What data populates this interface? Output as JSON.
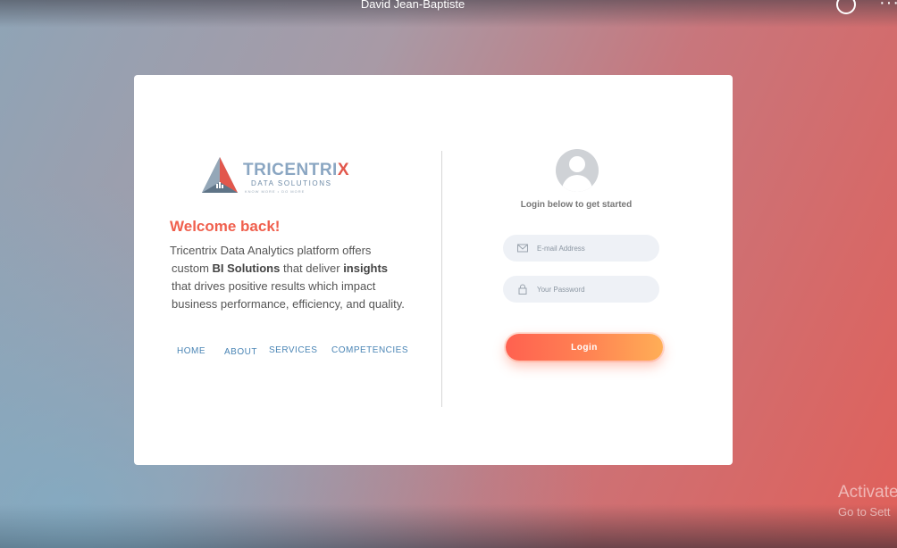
{
  "topbar": {
    "user_name": "David Jean-Baptiste",
    "menu_glyph": "···"
  },
  "logo": {
    "name_main": "TRICENTRI",
    "name_x": "X",
    "subtitle": "DATA SOLUTIONS",
    "tagline": "KNOW MORE • DO MORE"
  },
  "left": {
    "welcome": "Welcome back!",
    "desc_line1": "Tricentrix Data Analytics platform offers",
    "desc_line2_pre": "custom ",
    "desc_line2_bold1": "BI Solutions",
    "desc_line2_mid": " that deliver ",
    "desc_line2_bold2": "insights",
    "desc_line3": "that drives positive results which impact",
    "desc_line4": "business performance, efficiency, and quality.",
    "nav": [
      "HOME",
      "ABOUT",
      "SERVICES",
      "COMPETENCIES"
    ]
  },
  "right": {
    "subtitle": "Login below to get started",
    "email_placeholder": "E-mail Address",
    "password_placeholder": "Your Password",
    "login_label": "Login"
  },
  "watermark": {
    "line1": "Activate",
    "line2": "Go to Sett"
  },
  "colors": {
    "accent": "#f0604e",
    "nav": "#4a85b5",
    "button_start": "#ff6150",
    "button_end": "#ffae56"
  },
  "icons": [
    "user-avatar-icon",
    "mail-icon",
    "lock-icon",
    "emoji-icon"
  ]
}
